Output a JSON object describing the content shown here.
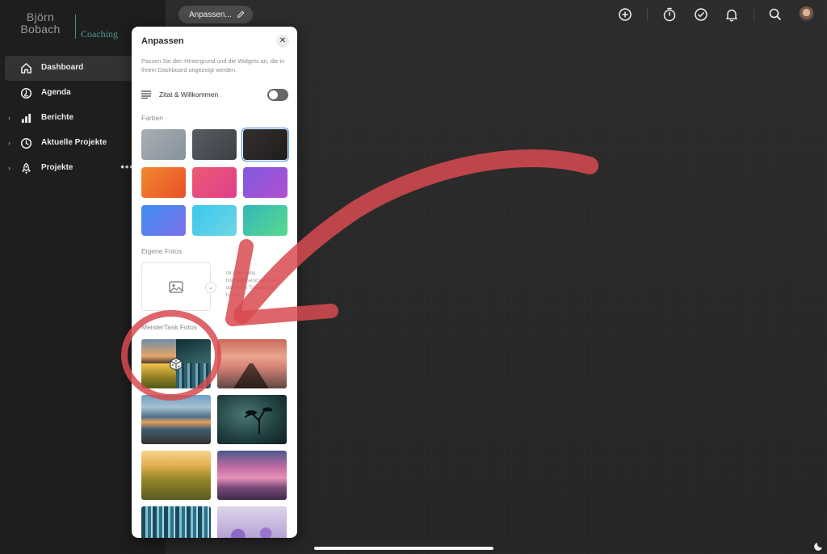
{
  "logo": {
    "name_line1": "Björn",
    "name_line2": "Bobach",
    "sub": "Coaching"
  },
  "sidebar": {
    "items": [
      {
        "label": "Dashboard",
        "icon": "home-icon",
        "active": true
      },
      {
        "label": "Agenda",
        "icon": "agenda-icon",
        "active": false
      },
      {
        "label": "Berichte",
        "icon": "bar-chart-icon",
        "active": false
      },
      {
        "label": "Aktuelle Projekte",
        "icon": "clock-icon",
        "active": false
      },
      {
        "label": "Projekte",
        "icon": "rocket-icon",
        "active": false,
        "more": "•••"
      }
    ]
  },
  "header": {
    "title": "Anpassen...",
    "icons": [
      "plus-circle-icon",
      "timer-icon",
      "check-circle-icon",
      "bell-icon",
      "search-icon",
      "avatar"
    ]
  },
  "panel": {
    "title": "Anpassen",
    "close": "✕",
    "description": "Passen Sie den Hintergrund und die Widgets an, die in Ihrem Dashboard angezeigt werden.",
    "toggle_label": "Zitat & Willkommen",
    "toggle_on": false,
    "colors_label": "Farben",
    "colors": [
      "#9aa3ab",
      "#4a4f55",
      "#2a2626",
      "#ef6a2a",
      "#e44d7a",
      "#9a52d8",
      "#4d8ff0",
      "#4fc6e6",
      "#45c7a4"
    ],
    "selected_color_index": 2,
    "own_photos_label": "Eigene Fotos",
    "own_photos_hint": "Ihr Foto sollte hochauflösend sein und darf keine Transparenz haben.",
    "meistertask_label": "MeisterTask Fotos",
    "photos": [
      "random-photo",
      "jetty-sunset",
      "mountain-lake",
      "lone-tree",
      "wheat-field",
      "pier-dusk",
      "blue-forest",
      "lavender"
    ]
  },
  "annotation": {
    "color": "#d84a4f"
  }
}
